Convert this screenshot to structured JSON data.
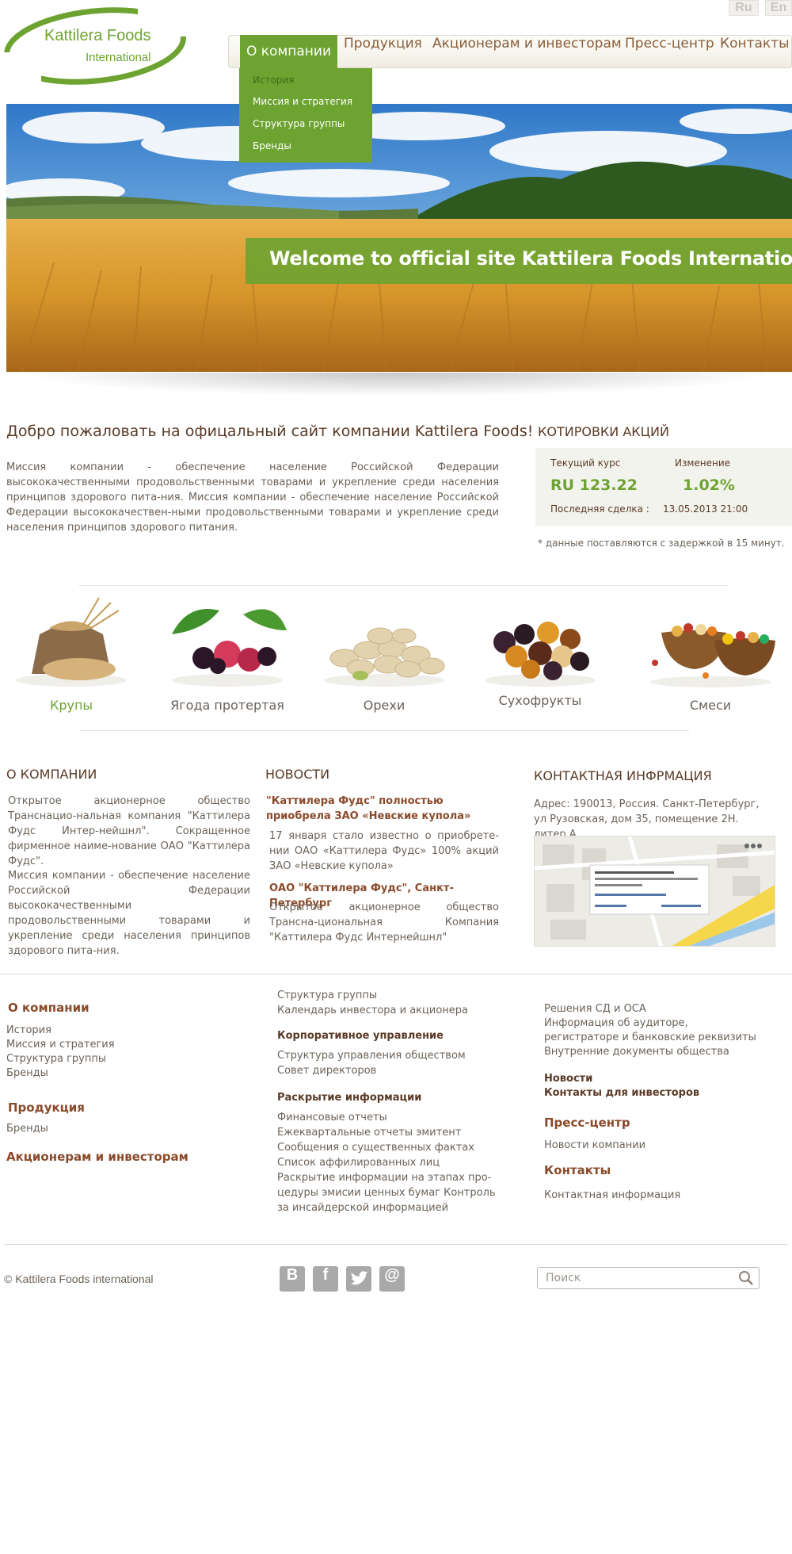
{
  "header": {
    "logo_line1": "Kattilera Foods",
    "logo_line2": "International",
    "lang": [
      "Ru",
      "En"
    ]
  },
  "nav": {
    "items": [
      "О компании",
      "Продукция",
      "Акционерам и инвесторам",
      "Пресс-центр",
      "Контакты"
    ],
    "dropdown": [
      "История",
      "Миссия и стратегия",
      "Структура группы",
      "Бренды"
    ]
  },
  "hero": {
    "text": "Welcome to official site Kattilera Foods International"
  },
  "welcome": {
    "title": "Добро пожаловать на офицальный сайт компании Kattilera Foods!",
    "mission": "Миссия компании - обеспечение население Российской Федерации высококачественными продовольственными товарами и укрепление среди населения принципов здорового пита-ния. Миссия компании - обеспечение население Российской Федерации высококачествен-ными продовольственными товарами и укрепление среди населения принципов здорового питания."
  },
  "stocks": {
    "title": "КОТИРОВКИ АКЦИЙ",
    "current_label": "Текущий курс",
    "change_label": "Изменение",
    "current_value": "RU 123.22",
    "change_value": "1.02%",
    "last_label": "Последняя сделка :",
    "last_value": "13.05.2013 21:00",
    "note": "* данные поставляются с задержкой в 15 минут."
  },
  "products": [
    "Крупы",
    "Ягода протертая",
    "Орехи",
    "Сухофрукты",
    "Смеси"
  ],
  "about": {
    "title": "О КОМПАНИИ",
    "p1": "Открытое акционерное общество Транснацио-нальная компания \"Каттилера Фудс Интер-нейшнл\". Сокращенное фирменное наиме-нование ОАО \"Каттилера Фудс\".",
    "p2": "Миссия компании - обеспечение население Российской Федерации высококачественными продовольственными товарами и укрепление среди населения принципов здорового пита-ния."
  },
  "news": {
    "title": "НОВОСТИ",
    "items": [
      {
        "head": "\"Каттилера Фудс\" полностью приобрела ЗАО «Невские купола»",
        "text": "17 января стало известно о приобрете-нии ОАО «Каттилера Фудс» 100% акций ЗАО «Невские купола»"
      },
      {
        "head": "ОАО \"Каттилера Фудс\", Санкт-Петербург",
        "text": "Открытое акционерное общество Трансна-циональная Компания \"Каттилера Фудс Интернейшнл\""
      }
    ]
  },
  "contacts": {
    "title": "КОНТАКТНАЯ ИНФРМАЦИЯ",
    "address": "Адрес: 190013, Россия. Санкт-Петербург, ул Рузовская, дом 35, помещение 2Н. литер А"
  },
  "footer": {
    "col1": {
      "about_title": "О компании",
      "about_links": [
        "История",
        "Миссия и стратегия",
        "Структура группы",
        "Бренды"
      ],
      "products_title": "Продукция",
      "products_links": [
        "Бренды"
      ],
      "investors_title": "Акционерам и инвесторам"
    },
    "col2": {
      "links_top": [
        "Структура группы",
        "Календарь инвестора и акционера"
      ],
      "corp_title": "Корпоративное управление",
      "corp_links": [
        "Структура управления обществом",
        "Совет директоров"
      ],
      "disclosure_title": "Раскрытие информации",
      "disclosure_links": [
        "Финансовые отчеты",
        "Ежеквартальные отчеты эмитент",
        "Сообщения о существенных фактах",
        "Список аффилированных лиц",
        "Раскрытие информации на этапах про-",
        "цедуры эмисии ценных бумаг Контроль",
        "за инсайдерской информацией"
      ]
    },
    "col3": {
      "links_top": [
        "Решения СД и ОСА",
        "Информация об аудиторе,",
        "регистраторе и банковские реквизиты",
        "Внутренние документы общества"
      ],
      "news_link": "Новости",
      "investor_contacts": "Контакты для инвесторов",
      "press_title": "Пресс-центр",
      "press_links": [
        "Новости компании"
      ],
      "contacts_title": "Контакты",
      "contacts_links": [
        "Контактная информация"
      ]
    },
    "copyright": "©  Kattilera Foods international",
    "search_placeholder": "Поиск"
  },
  "colors": {
    "brand_green": "#6da331",
    "brown": "#8a4a2a",
    "text": "#6b6259"
  },
  "icons": [
    "vk-icon",
    "facebook-icon",
    "twitter-icon",
    "email-icon",
    "search-icon"
  ]
}
